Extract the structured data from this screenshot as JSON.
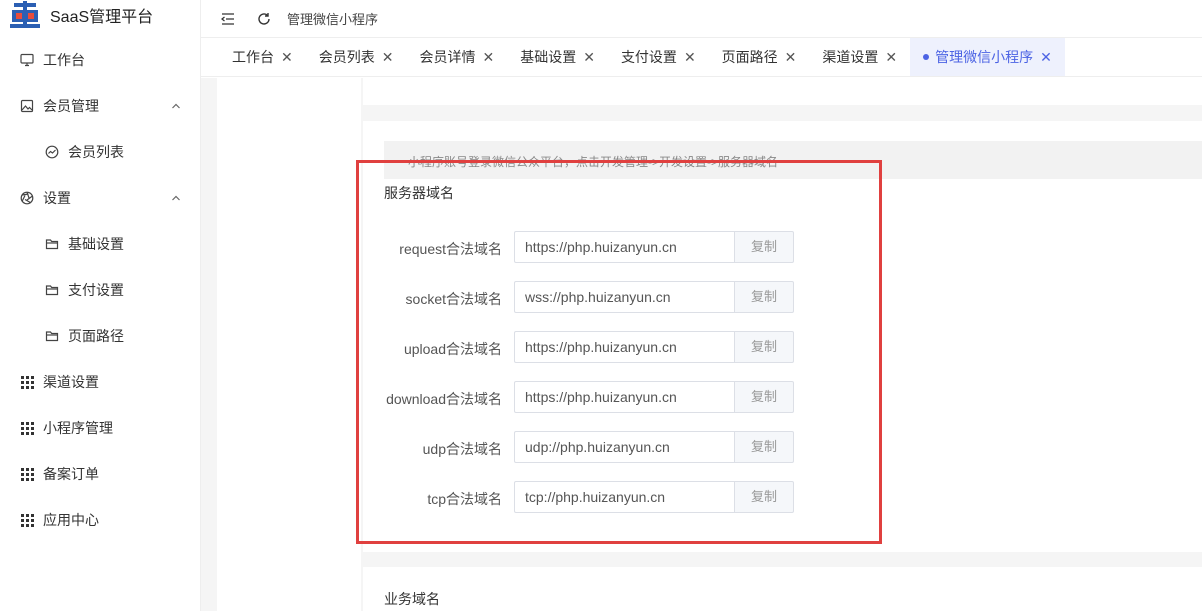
{
  "app": {
    "title": "SaaS管理平台"
  },
  "topbar": {
    "breadcrumb": "管理微信小程序"
  },
  "sidebar": {
    "items": [
      {
        "label": "工作台",
        "icon": "monitor-icon",
        "level": 1
      },
      {
        "label": "会员管理",
        "icon": "image-icon",
        "level": 1,
        "expanded": true
      },
      {
        "label": "会员列表",
        "icon": "chart-icon",
        "level": 2
      },
      {
        "label": "设置",
        "icon": "aperture-icon",
        "level": 1,
        "expanded": true
      },
      {
        "label": "基础设置",
        "icon": "folder-icon",
        "level": 2
      },
      {
        "label": "支付设置",
        "icon": "folder-icon",
        "level": 2
      },
      {
        "label": "页面路径",
        "icon": "folder-icon",
        "level": 2
      },
      {
        "label": "渠道设置",
        "icon": "grid-icon",
        "level": 1
      },
      {
        "label": "小程序管理",
        "icon": "grid-icon",
        "level": 1
      },
      {
        "label": "备案订单",
        "icon": "grid-icon",
        "level": 1
      },
      {
        "label": "应用中心",
        "icon": "grid-icon",
        "level": 1
      }
    ]
  },
  "tabs": [
    {
      "label": "工作台",
      "active": false
    },
    {
      "label": "会员列表",
      "active": false
    },
    {
      "label": "会员详情",
      "active": false
    },
    {
      "label": "基础设置",
      "active": false
    },
    {
      "label": "支付设置",
      "active": false
    },
    {
      "label": "页面路径",
      "active": false
    },
    {
      "label": "渠道设置",
      "active": false
    },
    {
      "label": "管理微信小程序",
      "active": true
    }
  ],
  "server_domain": {
    "tip": "小程序账号登录微信公众平台，点击开发管理->开发设置->服务器域名",
    "title": "服务器域名",
    "copy_label": "复制",
    "rows": [
      {
        "label": "request合法域名",
        "value": "https://php.huizanyun.cn"
      },
      {
        "label": "socket合法域名",
        "value": "wss://php.huizanyun.cn"
      },
      {
        "label": "upload合法域名",
        "value": "https://php.huizanyun.cn"
      },
      {
        "label": "download合法域名",
        "value": "https://php.huizanyun.cn"
      },
      {
        "label": "udp合法域名",
        "value": "udp://php.huizanyun.cn"
      },
      {
        "label": "tcp合法域名",
        "value": "tcp://php.huizanyun.cn"
      }
    ]
  },
  "business_domain": {
    "title": "业务域名"
  },
  "colors": {
    "accent": "#4c63e4",
    "highlight": "#e0403f",
    "logo_blue": "#2b5fb3"
  }
}
